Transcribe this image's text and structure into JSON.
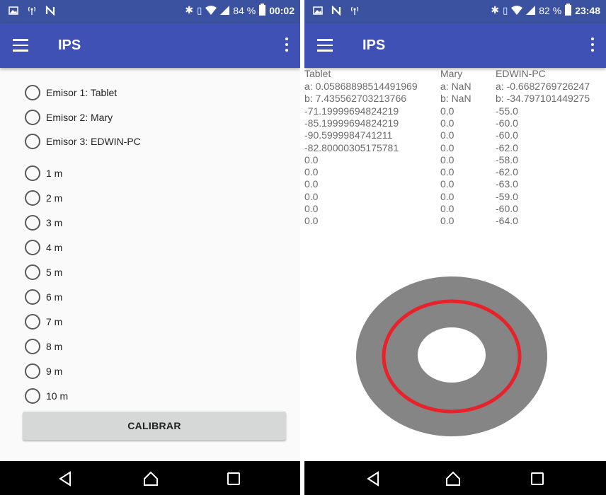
{
  "left_screen": {
    "status": {
      "battery": "84 %",
      "time": "00:02"
    },
    "app_title": "IPS",
    "emitters": [
      {
        "label": "Emisor 1: Tablet"
      },
      {
        "label": "Emisor 2: Mary"
      },
      {
        "label": "Emisor 3: EDWIN-PC"
      }
    ],
    "distances": [
      {
        "label": "1 m"
      },
      {
        "label": "2 m"
      },
      {
        "label": "3 m"
      },
      {
        "label": "4 m"
      },
      {
        "label": "5 m"
      },
      {
        "label": "6 m"
      },
      {
        "label": "7 m"
      },
      {
        "label": "8 m"
      },
      {
        "label": "9 m"
      },
      {
        "label": "10 m"
      }
    ],
    "calibrate_label": "CALIBRAR"
  },
  "right_screen": {
    "status": {
      "battery": "82 %",
      "time": "23:48"
    },
    "app_title": "IPS",
    "table": {
      "headers": [
        "Tablet",
        "Mary",
        "EDWIN-PC"
      ],
      "rows": [
        [
          "a: 0.05868898514491969",
          "a: NaN",
          "a: -0.6682769726247"
        ],
        [
          "b: 7.435562703213766",
          "b: NaN",
          "b: -34.797101449275"
        ],
        [
          "-71.19999694824219",
          "0.0",
          "-55.0"
        ],
        [
          "-85.19999694824219",
          "0.0",
          "-60.0"
        ],
        [
          "-90.5999984741211",
          "0.0",
          "-60.0"
        ],
        [
          "-82.80000305175781",
          "0.0",
          "-62.0"
        ],
        [
          "0.0",
          "0.0",
          "-58.0"
        ],
        [
          "0.0",
          "0.0",
          "-62.0"
        ],
        [
          "0.0",
          "0.0",
          "-63.0"
        ],
        [
          "0.0",
          "0.0",
          "-59.0"
        ],
        [
          "0.0",
          "0.0",
          "-60.0"
        ],
        [
          "0.0",
          "0.0",
          "-64.0"
        ]
      ]
    },
    "ring_colors": {
      "band": "#858585",
      "circle": "#e8222a",
      "inner": "#ffffff"
    }
  },
  "theme": {
    "primary": "#3f51b5",
    "status_bar": "#3a52a0",
    "nav_bar": "#000000"
  },
  "icons": [
    "menu-icon",
    "overflow-menu-icon",
    "back-icon",
    "home-icon",
    "recents-icon"
  ]
}
